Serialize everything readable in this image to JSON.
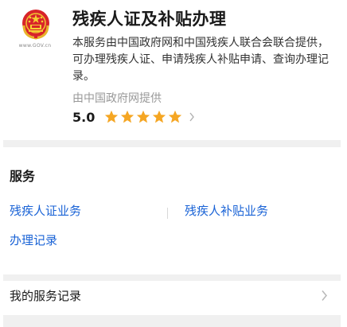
{
  "header": {
    "logo_text": "www.GOV.cn",
    "title": "残疾人证及补贴办理",
    "description": "本服务由中国政府网和中国残疾人联合会联合提供，可办理残疾人证、申请残疾人补贴申请、查询办理记录。",
    "provider": "由中国政府网提供",
    "rating": {
      "score": "5.0",
      "stars": 5,
      "star_color": "#f5a623"
    }
  },
  "services": {
    "section_title": "服务",
    "items": [
      {
        "label": "残疾人证业务"
      },
      {
        "label": "残疾人补贴业务"
      },
      {
        "label": "办理记录"
      }
    ],
    "link_color": "#1a63d6"
  },
  "records": {
    "label": "我的服务记录"
  }
}
